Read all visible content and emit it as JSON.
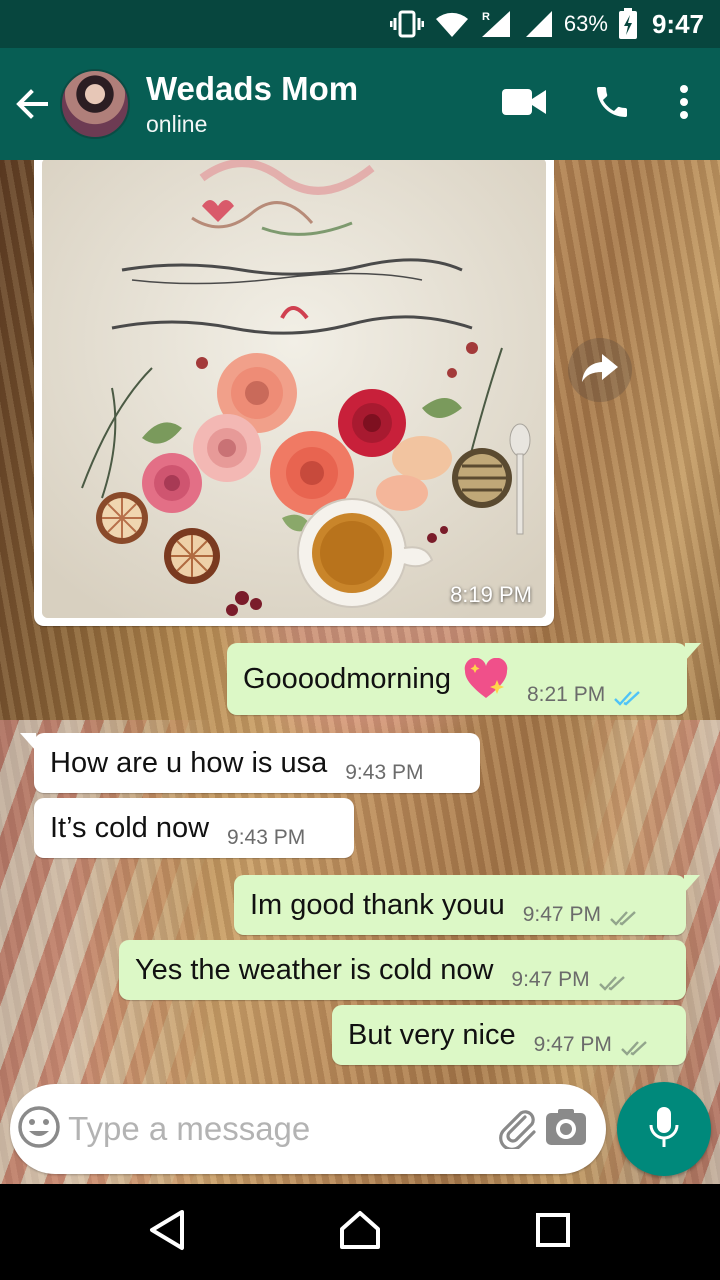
{
  "status_bar": {
    "battery_percent": "63%",
    "time": "9:47"
  },
  "header": {
    "contact_name": "Wedads Mom",
    "contact_status": "online"
  },
  "messages": {
    "image_message": {
      "time": "8:19 PM"
    },
    "m1": {
      "text": "Goooodmorning",
      "time": "8:21 PM",
      "status": "read"
    },
    "m2": {
      "text": "How are u how is usa",
      "time": "9:43 PM"
    },
    "m3": {
      "text": "It’s cold now",
      "time": "9:43 PM"
    },
    "m4": {
      "text": "Im good thank youu",
      "time": "9:47 PM",
      "status": "delivered"
    },
    "m5": {
      "text": "Yes the weather is cold now",
      "time": "9:47 PM",
      "status": "delivered"
    },
    "m6": {
      "text": "But very nice",
      "time": "9:47 PM",
      "status": "delivered"
    }
  },
  "input": {
    "placeholder": "Type a message"
  },
  "colors": {
    "header": "#075e54",
    "status_bar": "#07463e",
    "outgoing_bubble": "#dcf8c6",
    "incoming_bubble": "#ffffff",
    "read_ticks": "#4fc3f7",
    "delivered_ticks": "#92a58c",
    "mic_button": "#00897b"
  },
  "icons": [
    "vibrate-icon",
    "wifi-icon",
    "signal-icon",
    "battery-icon",
    "back-arrow-icon",
    "video-call-icon",
    "phone-icon",
    "more-vert-icon",
    "forward-icon",
    "double-check-icon",
    "sparkling-heart-icon",
    "emoji-icon",
    "attach-icon",
    "camera-icon",
    "mic-icon",
    "back-nav-icon",
    "home-nav-icon",
    "recents-nav-icon"
  ]
}
